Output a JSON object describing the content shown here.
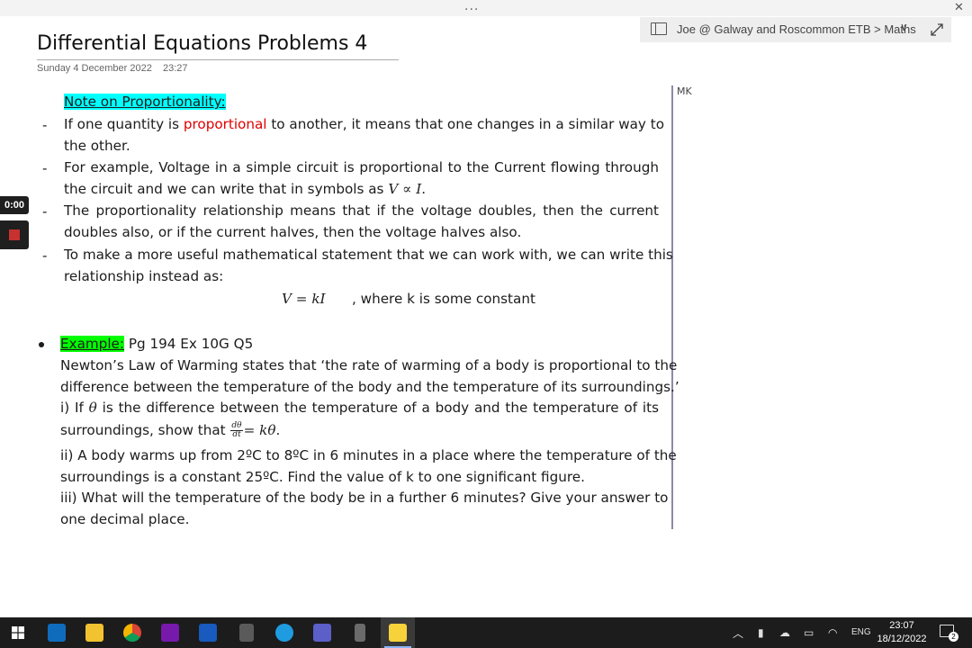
{
  "window": {
    "dots": "...",
    "close": "✕"
  },
  "breadcrumb": {
    "text": "Joe @ Galway and Roscommon ETB > Maths",
    "chevron": "∨",
    "expand": "⤢"
  },
  "page": {
    "title": "Differential Equations Problems 4",
    "date": "Sunday 4 December 2022",
    "time": "23:27",
    "side_note": "MK"
  },
  "recorder": {
    "timer": "0:00"
  },
  "note": {
    "heading": "Note on Proportionality:",
    "b1": {
      "dash": "-",
      "pre": "If one quantity is ",
      "highlight": "proportional",
      "post": " to another, it means that one changes in a similar way to",
      "line2": "the other."
    },
    "b2": {
      "dash": "-",
      "line1": "For example, Voltage in a simple circuit is proportional to the Current flowing through",
      "line2_pre": "the circuit and we can write that in symbols as ",
      "line2_math": "V ∝ I",
      "line2_post": "."
    },
    "b3": {
      "dash": "-",
      "line1": "The proportionality relationship means that if the voltage doubles, then the current",
      "line2": "doubles also, or if the current halves, then the voltage halves also."
    },
    "b4": {
      "dash": "-",
      "line1": "To make a more useful mathematical statement that we can work with, we can write this",
      "line2": "relationship instead as:",
      "equation": "V = kI",
      "equation_note": ", where k is some constant"
    },
    "example": {
      "label": "Example:",
      "ref": " Pg 194 Ex 10G Q5",
      "l1": "Newton’s Law of Warming states that ‘the rate of warming of a body is proportional to the",
      "l2": "difference between the temperature of the body and the temperature of its surroundings.’",
      "l3_pre": "i) If ",
      "l3_theta": "θ",
      "l3_post": " is the difference between the temperature of a body and the temperature of its",
      "l4_pre": "surroundings, show that ",
      "l4_num": "dθ",
      "l4_den": "dt",
      "l4_eq": "= kθ",
      "l4_post": ".",
      "l5": "ii) A body warms up from 2ºC to 8ºC in 6 minutes in a place where the temperature of the",
      "l6": "surroundings is a constant 25ºC. Find the value of k to one significant figure.",
      "l7": "iii) What will the temperature of the body be in a further 6 minutes? Give your answer to",
      "l8": "one decimal place."
    }
  },
  "taskbar": {
    "apps": [
      "Outlook",
      "File Explorer",
      "Chrome",
      "OneNote",
      "Word",
      "Calculator",
      "Edge",
      "Teams",
      "Phone",
      "Sticky Notes"
    ],
    "lang": "ENG",
    "time": "23:07",
    "date": "18/12/2022",
    "notifications": "2"
  },
  "colors": {
    "cyan_highlight": "#00ffff",
    "green_highlight": "#00ff00",
    "red_text": "#e00000",
    "taskbar": "#1c1c1c"
  }
}
